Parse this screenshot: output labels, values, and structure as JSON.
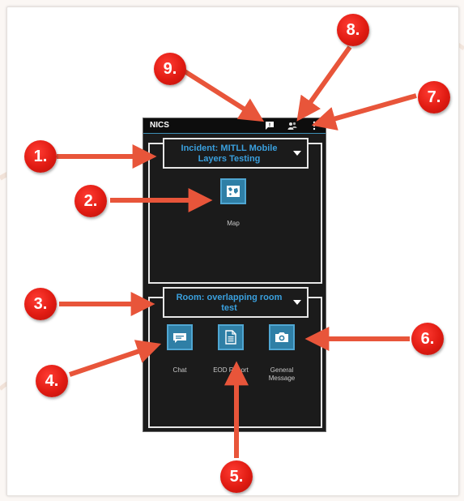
{
  "app": {
    "title": "NICS"
  },
  "status_icons": [
    "chat-alert-icon",
    "users-icon",
    "overflow-menu-icon"
  ],
  "incident": {
    "label": "Incident: MITLL Mobile Layers Testing"
  },
  "map_tile": {
    "label": "Map",
    "icon": "map-icon"
  },
  "room": {
    "label": "Room: overlapping room test"
  },
  "room_tiles": [
    {
      "label": "Chat",
      "icon": "chat-icon"
    },
    {
      "label": "EOD Report",
      "icon": "document-icon"
    },
    {
      "label": "General Message",
      "icon": "camera-icon"
    }
  ],
  "callouts": [
    "1.",
    "2.",
    "3.",
    "4.",
    "5.",
    "6.",
    "7.",
    "8.",
    "9."
  ],
  "colors": {
    "accent": "#3aa0de",
    "marker": "#e01b12",
    "arrow": "#e8553a"
  }
}
